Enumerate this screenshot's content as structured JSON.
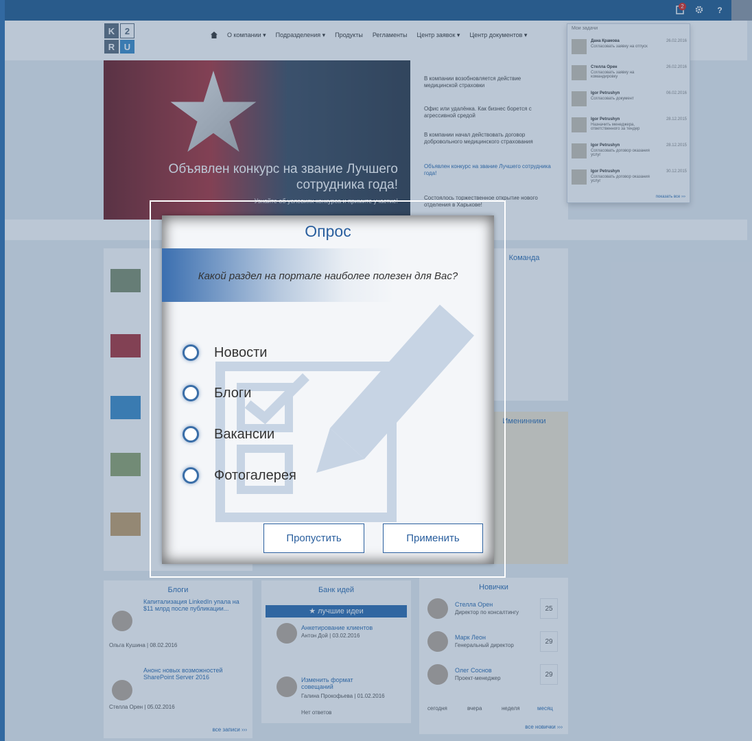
{
  "topbar": {
    "notification_count": "2",
    "help_label": "?"
  },
  "logo": {
    "letters": [
      "K",
      "2",
      "R",
      "U"
    ]
  },
  "nav": {
    "items": [
      "О компании ▾",
      "Подразделения ▾",
      "Продукты",
      "Регламенты",
      "Центр заявок ▾",
      "Центр документов ▾"
    ]
  },
  "hero": {
    "caption": "Объявлен конкурс на звание Лучшего сотрудника года!",
    "subcaption": "Узнайте об условиях конкурса и примите участие!"
  },
  "news": {
    "items": [
      "В компании возобновляется действие медицинской страховки",
      "Офис или удалёнка. Как бизнес борется с агрессивной средой",
      "В компании начал действовать договор добровольного медицинского страхования",
      "Объявлен конкурс на звание Лучшего сотрудника года!",
      "Состоялось торжественное открытие нового отделения в Харькове!"
    ]
  },
  "notifications": {
    "title": "Мои задачи",
    "items": [
      {
        "name": "Дана Крамова",
        "text": "Согласовать заявку на отпуск",
        "date": "26.02.2016"
      },
      {
        "name": "Стелла Орен",
        "text": "Согласовать заявку на командировку",
        "date": "26.02.2016"
      },
      {
        "name": "Igor Petrushyn",
        "text": "Согласовать документ",
        "date": "06.02.2016"
      },
      {
        "name": "Igor Petrushyn",
        "text": "Назначить менеджера, ответственного за тендер",
        "date": "28.12.2015"
      },
      {
        "name": "Igor Petrushyn",
        "text": "Согласовать договор оказания услуг",
        "date": "28.12.2015"
      },
      {
        "name": "Igor Petrushyn",
        "text": "Согласовать договор оказания услуг",
        "date": "30.12.2015"
      }
    ],
    "show_all": "показать все ›››"
  },
  "widgets": {
    "blogs": {
      "title": "Блоги",
      "items": [
        {
          "title": "Капитализация LinkedIn упала на $11 млрд после публикации...",
          "meta": "Ольга Кушина | 08.02.2016"
        },
        {
          "title": "Анонс новых возможностей SharePoint Server 2016",
          "meta": "Стелла Орен | 05.02.2016"
        }
      ],
      "all": "все записи ›››"
    },
    "ideas": {
      "title": "Банк идей",
      "bar": "★ лучшие идеи",
      "items": [
        {
          "title": "Анкетирование клиентов",
          "meta": "Антон Дой | 03.02.2016"
        },
        {
          "title": "Изменить формат совещаний",
          "meta": "Галина Прокофьева | 01.02.2016"
        }
      ],
      "no_answers": "Нет ответов"
    },
    "newcomers": {
      "title": "Новички",
      "items": [
        {
          "name": "Стелла Орен",
          "role": "Директор по консалтингу",
          "day": "25"
        },
        {
          "name": "Марк Леон",
          "role": "Генеральный директор",
          "day": "29"
        },
        {
          "name": "Олег Соснов",
          "role": "Проект-менеджер",
          "day": "29"
        }
      ],
      "periods": [
        "сегодня",
        "вчера",
        "неделя",
        "месяц"
      ],
      "all": "все новички ›››"
    },
    "team_title": "Команда",
    "birthdays_title": "Именинники"
  },
  "poll": {
    "title": "Опрос",
    "question": "Какой раздел на портале наиболее полезен для Вас?",
    "options": [
      "Новости",
      "Блоги",
      "Вакансии",
      "Фотогалерея"
    ],
    "skip_label": "Пропустить",
    "apply_label": "Применить"
  },
  "colors": {
    "accent": "#2a5f9e",
    "topbar": "#1f5a8e"
  }
}
